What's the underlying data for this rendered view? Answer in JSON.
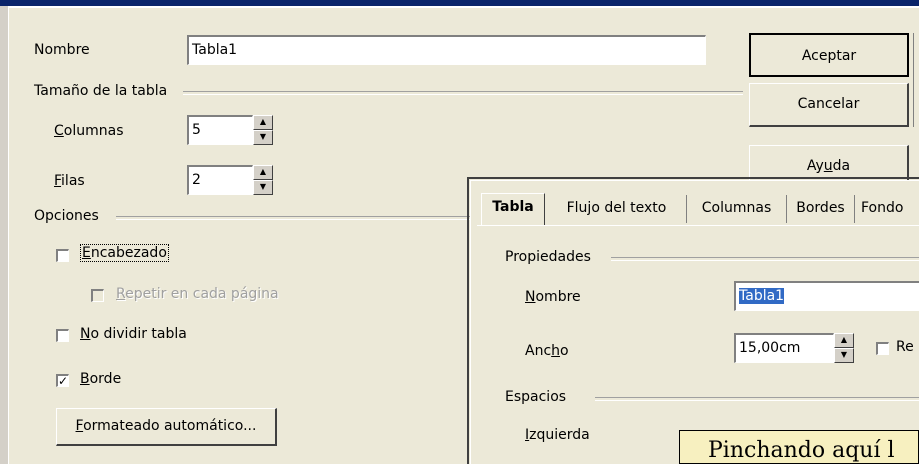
{
  "main_dialog": {
    "name_label": "Nombre",
    "name_value": "Tabla1",
    "size_group": "Tamaño de la tabla",
    "columns_label_u": "C",
    "columns_label_rest": "olumnas",
    "columns_value": "5",
    "rows_label_u": "F",
    "rows_label_rest": "ilas",
    "rows_value": "2",
    "options_group": "Opciones",
    "header_u": "E",
    "header_rest": "ncabezado",
    "header_checked": false,
    "repeat_u": "R",
    "repeat_rest": "epetir en cada página",
    "repeat_checked": false,
    "nosplit_u": "N",
    "nosplit_rest": "o dividir tabla",
    "nosplit_checked": false,
    "border_u": "B",
    "border_rest": "orde",
    "border_checked": true,
    "autoformat_u": "F",
    "autoformat_rest": "ormateado automático...",
    "ok_label": "Aceptar",
    "cancel_label": "Cancelar",
    "help_pre": "Ay",
    "help_u": "u",
    "help_post": "da"
  },
  "properties_dialog": {
    "tabs": [
      "Tabla",
      "Flujo del texto",
      "Columnas",
      "Bordes",
      "Fondo"
    ],
    "active_tab": "Tabla",
    "properties_group": "Propiedades",
    "name_u": "N",
    "name_rest": "ombre",
    "name_value": "Tabla1",
    "width_pre": "Anc",
    "width_u": "h",
    "width_post": "o",
    "width_value": "15,00cm",
    "relative_partial": "Re",
    "spacing_group": "Espacios",
    "left_u": "I",
    "left_rest": "zquierda"
  },
  "callout": {
    "text": "Pinchando aquí l"
  },
  "colors": {
    "dialog_bg": "#ece9d8",
    "selection": "#316ac5",
    "callout_bg": "#f7f0c0"
  }
}
